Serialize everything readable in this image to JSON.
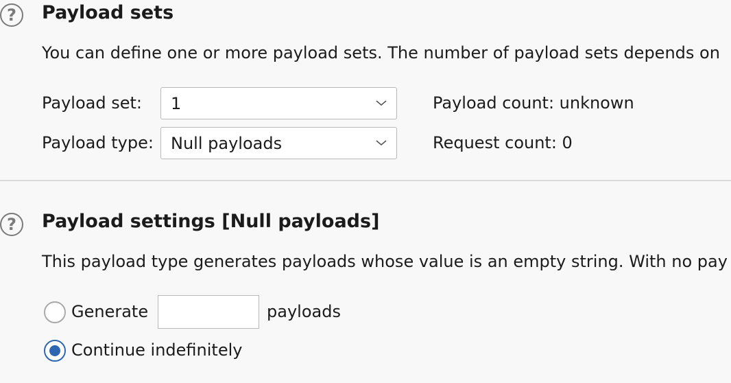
{
  "payload_sets": {
    "help_icon": "?",
    "title": "Payload sets",
    "description": "You can define one or more payload sets. The number of payload sets depends on",
    "payload_set_label": "Payload set:",
    "payload_set_value": "1",
    "payload_type_label": "Payload type:",
    "payload_type_value": "Null payloads",
    "payload_count": "Payload count: unknown",
    "request_count": "Request count: 0"
  },
  "payload_settings": {
    "help_icon": "?",
    "title": "Payload settings [Null payloads]",
    "description": "This payload type generates payloads whose value is an empty string. With no pay",
    "generate_label": "Generate",
    "generate_value": "",
    "payloads_suffix": "payloads",
    "continue_label": "Continue indefinitely",
    "selected_option": "Continue indefinitely"
  },
  "icons": {
    "help": "question-mark-circle",
    "dropdown": "chevron-down"
  },
  "colors": {
    "background": "#f8f8f8",
    "accent": "#2e67b1",
    "border": "#b9b9b9"
  }
}
